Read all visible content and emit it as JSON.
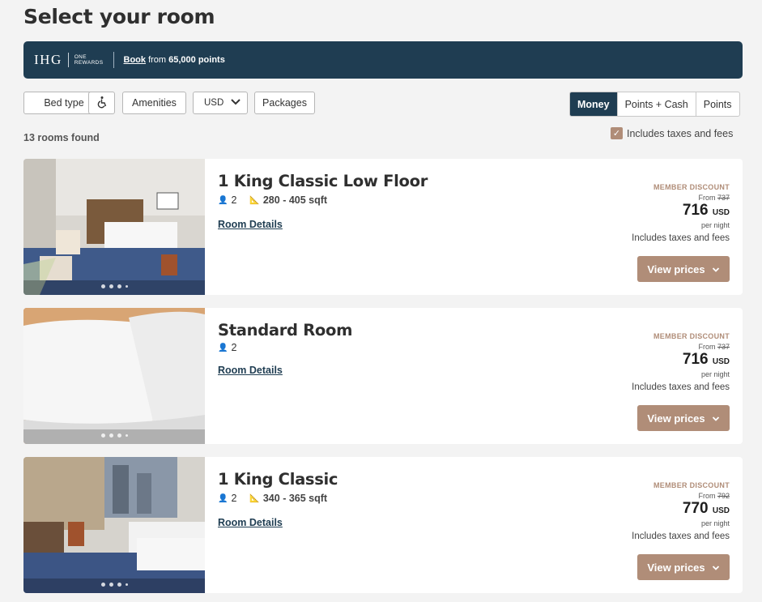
{
  "page": {
    "title": "Select your room"
  },
  "banner": {
    "logo_text": "IHG",
    "logo_sub_1": "ONE",
    "logo_sub_2": "REWARDS",
    "book_link": "Book",
    "book_text_mid": " from ",
    "book_points": "65,000 points"
  },
  "filters": {
    "bed_type": "Bed type",
    "amenities": "Amenities",
    "currency": "USD",
    "packages": "Packages"
  },
  "payment_toggle": {
    "money": "Money",
    "points_cash": "Points + Cash",
    "points": "Points",
    "selected": "Money"
  },
  "results": {
    "count_text": "13 rooms found",
    "taxes_label": "Includes taxes and fees",
    "taxes_checked": true
  },
  "rooms": [
    {
      "name": "1 King Classic Low Floor",
      "guests": "2",
      "size": "280 - 405 sqft",
      "details_link": "Room Details",
      "badge": "MEMBER DISCOUNT",
      "from_label": "From",
      "original_price": "737",
      "price": "716",
      "currency": "USD",
      "per_night": "per night",
      "taxes_note": "Includes taxes and fees",
      "cta": "View prices"
    },
    {
      "name": "Standard Room",
      "guests": "2",
      "size": "",
      "details_link": "Room Details",
      "badge": "MEMBER DISCOUNT",
      "from_label": "From",
      "original_price": "737",
      "price": "716",
      "currency": "USD",
      "per_night": "per night",
      "taxes_note": "Includes taxes and fees",
      "cta": "View prices"
    },
    {
      "name": "1 King Classic",
      "guests": "2",
      "size": "340 - 365 sqft",
      "details_link": "Room Details",
      "badge": "MEMBER DISCOUNT",
      "from_label": "From",
      "original_price": "792",
      "price": "770",
      "currency": "USD",
      "per_night": "per night",
      "taxes_note": "Includes taxes and fees",
      "cta": "View prices"
    }
  ],
  "colors": {
    "navy": "#1f3d52",
    "accent": "#b08d78",
    "background": "#f3f3f3"
  }
}
